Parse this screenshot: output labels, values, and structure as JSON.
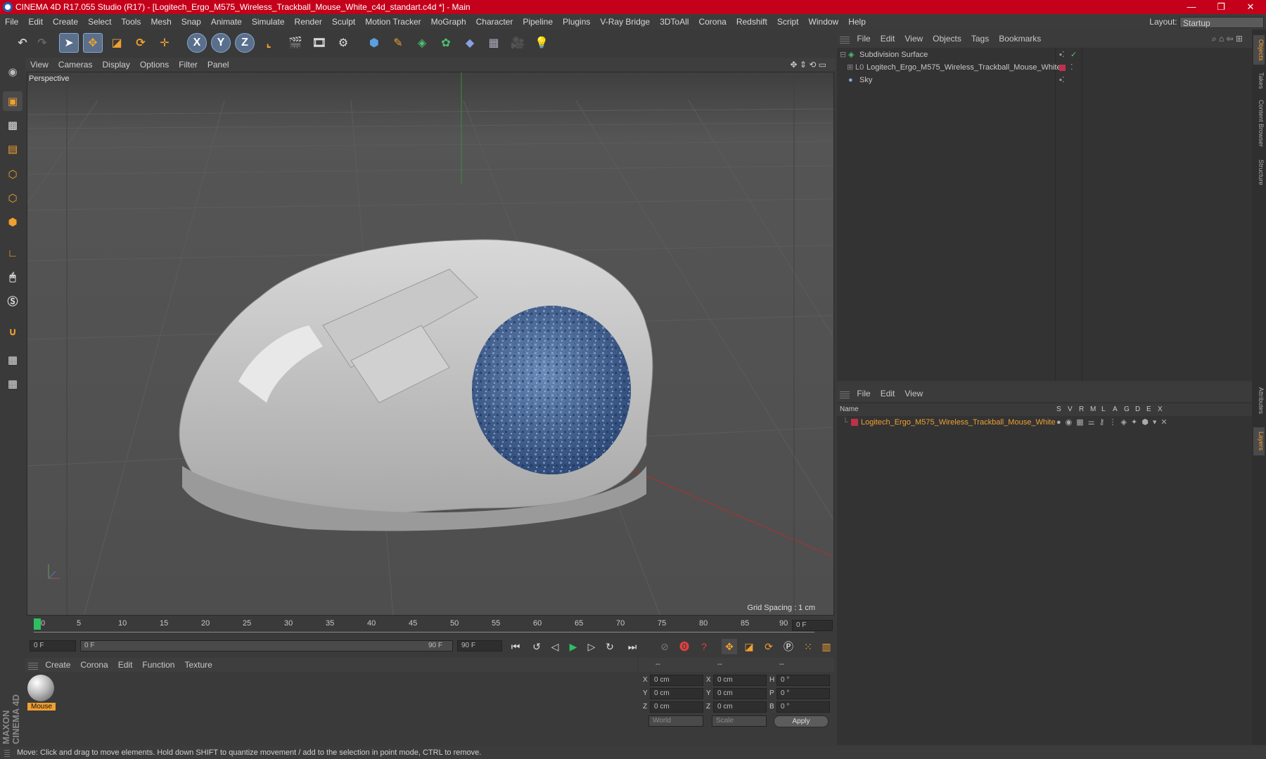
{
  "window": {
    "title": "CINEMA 4D R17.055 Studio (R17) - [Logitech_Ergo_M575_Wireless_Trackball_Mouse_White_c4d_standart.c4d *] - Main",
    "controls": [
      "—",
      "❐",
      "✕"
    ]
  },
  "menubar": {
    "items": [
      "File",
      "Edit",
      "Create",
      "Select",
      "Tools",
      "Mesh",
      "Snap",
      "Animate",
      "Simulate",
      "Render",
      "Sculpt",
      "Motion Tracker",
      "MoGraph",
      "Character",
      "Pipeline",
      "Plugins",
      "V-Ray Bridge",
      "3DToAll",
      "Corona",
      "Redshift",
      "Script",
      "Window",
      "Help"
    ],
    "layout_label": "Layout:",
    "layout_value": "Startup"
  },
  "toolbar": {
    "axis_x": "X",
    "axis_y": "Y",
    "axis_z": "Z"
  },
  "viewport": {
    "menu": [
      "View",
      "Cameras",
      "Display",
      "Options",
      "Filter",
      "Panel"
    ],
    "camera_label": "Perspective",
    "grid_spacing": "Grid Spacing : 1 cm"
  },
  "timeline": {
    "ticks": [
      "0",
      "5",
      "10",
      "15",
      "20",
      "25",
      "30",
      "35",
      "40",
      "45",
      "50",
      "55",
      "60",
      "65",
      "70",
      "75",
      "80",
      "85",
      "90"
    ],
    "current_frame": "0 F",
    "start_field": "0 F",
    "range_start": "0 F",
    "range_end": "90 F",
    "end_field": "90 F"
  },
  "material_panel": {
    "menu": [
      "Create",
      "Corona",
      "Edit",
      "Function",
      "Texture"
    ],
    "materials": [
      {
        "name": "Mouse"
      }
    ]
  },
  "coord_panel": {
    "headers": [
      "--",
      "--",
      "--"
    ],
    "rows": [
      {
        "a": "X",
        "av": "0 cm",
        "b": "X",
        "bv": "0 cm",
        "c": "H",
        "cv": "0 °"
      },
      {
        "a": "Y",
        "av": "0 cm",
        "b": "Y",
        "bv": "0 cm",
        "c": "P",
        "cv": "0 °"
      },
      {
        "a": "Z",
        "av": "0 cm",
        "b": "Z",
        "bv": "0 cm",
        "c": "B",
        "cv": "0 °"
      }
    ],
    "mode1": "World",
    "mode2": "Scale",
    "apply": "Apply"
  },
  "object_manager": {
    "menu": [
      "File",
      "Edit",
      "View",
      "Objects",
      "Tags",
      "Bookmarks"
    ],
    "objects": [
      {
        "name": "Subdivision Surface"
      },
      {
        "name": "Logitech_Ergo_M575_Wireless_Trackball_Mouse_White"
      },
      {
        "name": "Sky"
      }
    ]
  },
  "layer_manager": {
    "menu": [
      "File",
      "Edit",
      "View"
    ],
    "columns": [
      "Name",
      "S",
      "V",
      "R",
      "M",
      "L",
      "A",
      "G",
      "D",
      "E",
      "X"
    ],
    "layers": [
      {
        "name": "Logitech_Ergo_M575_Wireless_Trackball_Mouse_White"
      }
    ]
  },
  "side_tabs": [
    "Objects",
    "Takes",
    "Content Browser",
    "Structure",
    "Attributes",
    "Layers"
  ],
  "brand": "MAXON CINEMA 4D",
  "status": "Move: Click and drag to move elements. Hold down SHIFT to quantize movement / add to the selection in point mode, CTRL to remove.",
  "colors": {
    "titlebar": "#c4001a",
    "accent": "#f0a030",
    "layer_red": "#c0304a"
  }
}
